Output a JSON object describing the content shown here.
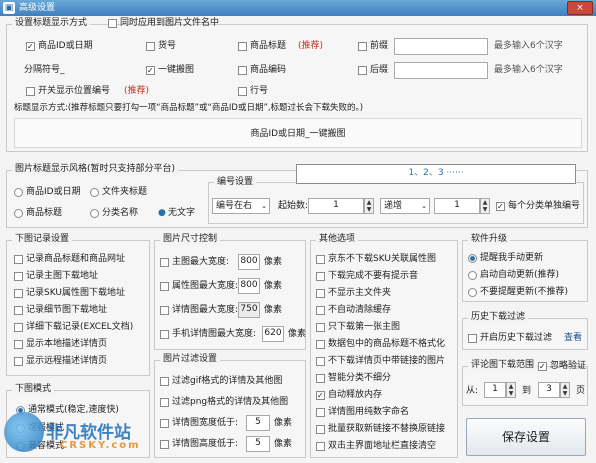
{
  "window": {
    "title": "高级设置",
    "close": "×"
  },
  "title_settings": {
    "group_title": "设置标题显示方式",
    "sync_label": "同时应用到图片文件名中",
    "product_id": "商品ID或日期",
    "item_no": "货号",
    "product_title": "商品标题",
    "recommend1": "(推荐)",
    "prefix": "前缀",
    "hint1": "最多输入6个汉字",
    "separator": "分隔符号_",
    "one_key": "一键搬图",
    "product_code": "商品编码",
    "suffix": "后缀",
    "hint2": "最多输入6个汉字",
    "switch_pos": "开关显示位置编号",
    "recommend2": "(推荐)",
    "line_no": "行号",
    "desc": "标题显示方式:(推荐标题只要打勾一项“商品标题”或“商品ID或日期”,标题过长会下载失败的。)",
    "preview": "商品ID或日期_一键搬图"
  },
  "image_title_style": {
    "group_title": "图片标题显示风格(暂时只支持部分平台)",
    "opt1": "商品ID或日期",
    "opt2": "文件夹标题",
    "opt3": "商品标题",
    "opt4": "分类名称",
    "opt5": "无文字",
    "numbering_title": "编号设置",
    "number_preview": "1、2、3 ······",
    "position": "编号在右",
    "start_label": "起始数:",
    "start_val": "1",
    "step_sel": "递增",
    "step_val": "1",
    "per_category": "每个分类单独编号"
  },
  "download_log": {
    "group_title": "下图记录设置",
    "items": [
      "记录商品标题和商品网址",
      "记录主图下载地址",
      "记录SKU属性图下载地址",
      "记录细节图下载地址",
      "详细下载记录(EXCEL文档)",
      "显示本地描述详情页",
      "显示远程描述详情页"
    ]
  },
  "image_size": {
    "group_title": "图片尺寸控制",
    "rows": [
      {
        "label": "主图最大宽度:",
        "value": "800",
        "unit": "像素"
      },
      {
        "label": "属性图最大宽度:",
        "value": "800",
        "unit": "像素"
      },
      {
        "label": "详情图最大宽度:",
        "value": "750",
        "unit": "像素"
      },
      {
        "label": "手机详情图最大宽度:",
        "value": "620",
        "unit": "像素"
      }
    ]
  },
  "image_filter": {
    "group_title": "图片过滤设置",
    "rows": [
      {
        "label": "过滤gif格式的详情及其他图"
      },
      {
        "label": "过滤png格式的详情及其他图"
      },
      {
        "label": "详情图宽度低于:",
        "value": "5",
        "unit": "像素"
      },
      {
        "label": "详情图高度低于:",
        "value": "5",
        "unit": "像素"
      }
    ]
  },
  "download_mode": {
    "group_title": "下图模式",
    "opt1": "通常模式(稳定,速度快)",
    "opt2": "增强模式",
    "opt3": "兼容模式"
  },
  "other_options": {
    "group_title": "其他选项",
    "items": [
      {
        "label": "京东不下载SKU关联属性图",
        "checked": false
      },
      {
        "label": "下载完成不要有提示音",
        "checked": false
      },
      {
        "label": "不显示主文件夹",
        "checked": false
      },
      {
        "label": "不自动清除缓存",
        "checked": false
      },
      {
        "label": "只下载第一张主图",
        "checked": false
      },
      {
        "label": "数据包中的商品标题不格式化",
        "checked": false
      },
      {
        "label": "不下载详情页中带链接的图片",
        "checked": false
      },
      {
        "label": "智能分类不细分",
        "checked": false
      },
      {
        "label": "自动释放内存",
        "checked": true
      },
      {
        "label": "详情图用纯数字命名",
        "checked": false
      },
      {
        "label": "批量获取新链接不替换原链接",
        "checked": false
      },
      {
        "label": "双击主界面地址栏直接清空",
        "checked": false
      }
    ]
  },
  "upgrade": {
    "group_title": "软件升级",
    "opt1": "提醒我手动更新",
    "opt2": "启动自动更新(推荐)",
    "opt3": "不要提醒更新(不推荐)"
  },
  "history_filter": {
    "group_title": "历史下载过滤",
    "enable": "开启历史下载过滤",
    "view": "查看"
  },
  "comment_range": {
    "group_title": "评论图下载范围",
    "ignore": "忽略验证",
    "from": "从:",
    "from_val": "1",
    "to": "到",
    "to_val": "3",
    "unit": "页"
  },
  "save_button": "保存设置",
  "watermark": {
    "text": "非凡软件站",
    "sub": "CRSKY.com"
  }
}
